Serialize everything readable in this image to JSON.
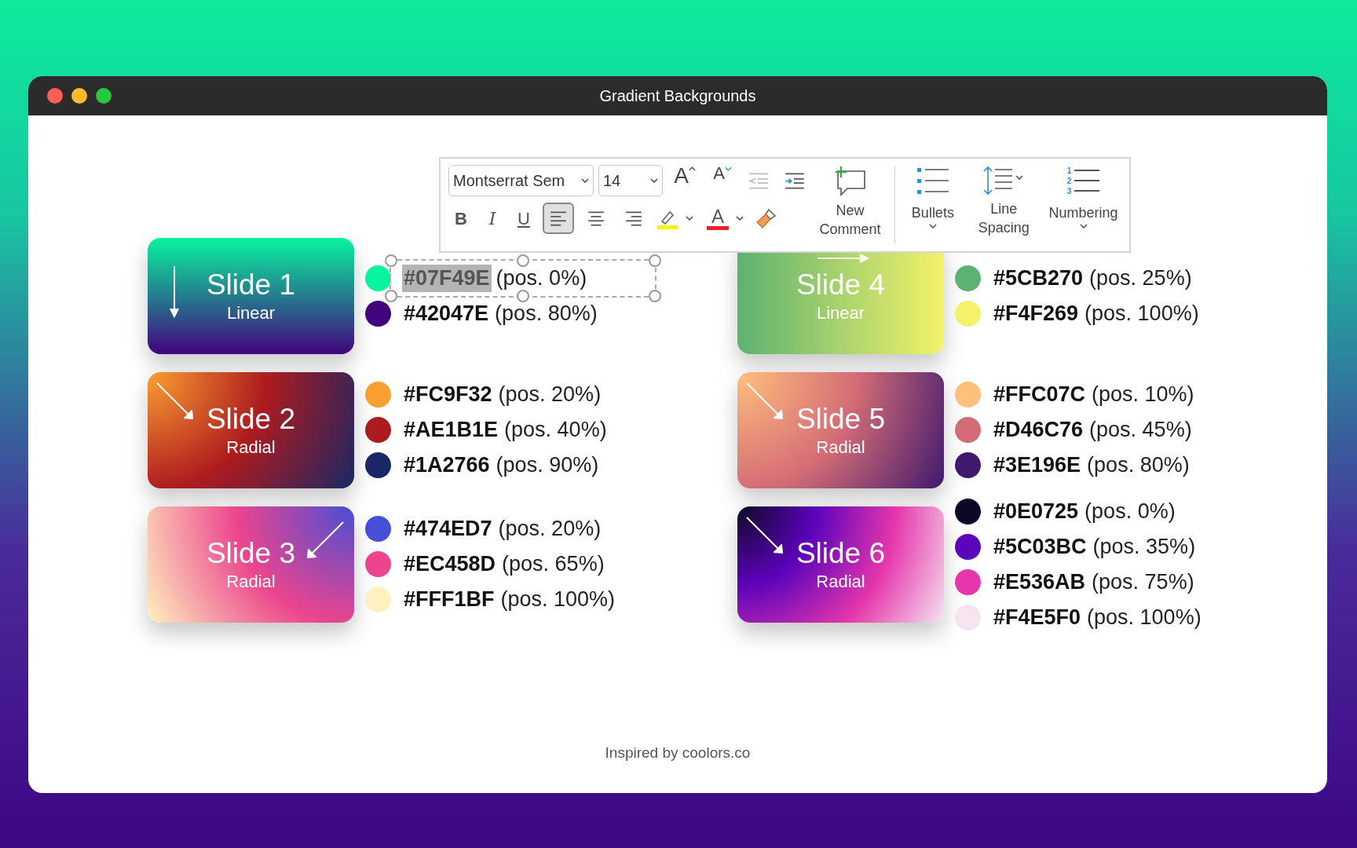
{
  "window": {
    "title": "Gradient Backgrounds"
  },
  "toolbar": {
    "font": "Montserrat Sem",
    "size": "14",
    "grow": "A",
    "shrink": "A",
    "bold": "B",
    "italic": "I",
    "underline": "U",
    "align": [
      {
        "kind": "left",
        "selected": true
      },
      {
        "kind": "center",
        "selected": false
      },
      {
        "kind": "right",
        "selected": false
      }
    ],
    "font_color": "A",
    "new_comment": "New Comment",
    "bullets": "Bullets",
    "line_spacing": "Line Spacing",
    "numbering": "Numbering",
    "numbering_digits": [
      "1",
      "2",
      "3"
    ]
  },
  "slides": [
    {
      "title": "Slide 1",
      "type": "Linear",
      "kind": "linear-down",
      "stops": [
        {
          "hex": "#07F49E",
          "pos": "(pos. 0%)",
          "color": "#07f49e",
          "selected": true
        },
        {
          "hex": "#42047E",
          "pos": "(pos. 80%)",
          "color": "#42047e",
          "selected": false
        }
      ]
    },
    {
      "title": "Slide 2",
      "type": "Radial",
      "kind": "radial-left",
      "stops": [
        {
          "hex": "#FC9F32",
          "pos": "(pos. 20%)",
          "color": "#fc9f32",
          "selected": false
        },
        {
          "hex": "#AE1B1E",
          "pos": "(pos. 40%)",
          "color": "#ae1b1e",
          "selected": false
        },
        {
          "hex": "#1A2766",
          "pos": "(pos. 90%)",
          "color": "#1a2766",
          "selected": false
        }
      ]
    },
    {
      "title": "Slide 3",
      "type": "Radial",
      "kind": "radial-right",
      "stops": [
        {
          "hex": "#474ED7",
          "pos": "(pos. 20%)",
          "color": "#474ed7",
          "selected": false
        },
        {
          "hex": "#EC458D",
          "pos": "(pos. 65%)",
          "color": "#ec458d",
          "selected": false
        },
        {
          "hex": "#FFF1BF",
          "pos": "(pos. 100%)",
          "color": "#fff1bf",
          "selected": false
        }
      ]
    },
    {
      "title": "Slide 4",
      "type": "Linear",
      "kind": "linear-right",
      "stops": [
        {
          "hex": "#5CB270",
          "pos": "(pos. 25%)",
          "color": "#5cb270",
          "selected": false
        },
        {
          "hex": "#F4F269",
          "pos": "(pos. 100%)",
          "color": "#f4f269",
          "selected": false
        }
      ]
    },
    {
      "title": "Slide 5",
      "type": "Radial",
      "kind": "radial-left",
      "stops": [
        {
          "hex": "#FFC07C",
          "pos": "(pos. 10%)",
          "color": "#ffc07c",
          "selected": false
        },
        {
          "hex": "#D46C76",
          "pos": "(pos. 45%)",
          "color": "#d46c76",
          "selected": false
        },
        {
          "hex": "#3E196E",
          "pos": "(pos. 80%)",
          "color": "#3e196e",
          "selected": false
        }
      ]
    },
    {
      "title": "Slide 6",
      "type": "Radial",
      "kind": "radial-left",
      "stops": [
        {
          "hex": "#0E0725",
          "pos": "(pos. 0%)",
          "color": "#0e0725",
          "selected": false
        },
        {
          "hex": "#5C03BC",
          "pos": "(pos. 35%)",
          "color": "#5c03bc",
          "selected": false
        },
        {
          "hex": "#E536AB",
          "pos": "(pos. 75%)",
          "color": "#e536ab",
          "selected": false
        },
        {
          "hex": "#F4E5F0",
          "pos": "(pos. 100%)",
          "color": "#f4e5f0",
          "selected": false
        }
      ]
    }
  ],
  "footer": "Inspired by coolors.co"
}
